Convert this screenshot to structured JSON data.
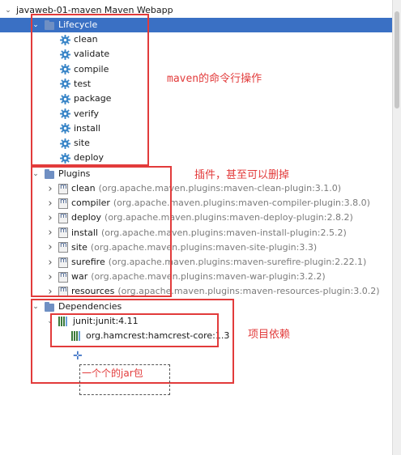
{
  "project": {
    "title": "javaweb-01-maven Maven Webapp"
  },
  "lifecycle": {
    "label": "Lifecycle",
    "items": [
      "clean",
      "validate",
      "compile",
      "test",
      "package",
      "verify",
      "install",
      "site",
      "deploy"
    ]
  },
  "plugins": {
    "label": "Plugins",
    "items": [
      {
        "name": "clean",
        "artifact": "(org.apache.maven.plugins:maven-clean-plugin:3.1.0)"
      },
      {
        "name": "compiler",
        "artifact": "(org.apache.maven.plugins:maven-compiler-plugin:3.8.0)"
      },
      {
        "name": "deploy",
        "artifact": "(org.apache.maven.plugins:maven-deploy-plugin:2.8.2)"
      },
      {
        "name": "install",
        "artifact": "(org.apache.maven.plugins:maven-install-plugin:2.5.2)"
      },
      {
        "name": "site",
        "artifact": "(org.apache.maven.plugins:maven-site-plugin:3.3)"
      },
      {
        "name": "surefire",
        "artifact": "(org.apache.maven.plugins:maven-surefire-plugin:2.22.1)"
      },
      {
        "name": "war",
        "artifact": "(org.apache.maven.plugins:maven-war-plugin:3.2.2)"
      },
      {
        "name": "resources",
        "artifact": "(org.apache.maven.plugins:maven-resources-plugin:3.0.2)"
      }
    ]
  },
  "dependencies": {
    "label": "Dependencies",
    "items": [
      {
        "name": "junit:junit:4.11",
        "children": [
          "org.hamcrest:hamcrest-core:1.3"
        ]
      }
    ]
  },
  "annotations": {
    "lifecycle_note": "maven的命令行操作",
    "plugins_note": "插件，甚至可以删掉",
    "dependencies_note": "项目依赖",
    "jar_note": "一个个的jar包"
  },
  "colors": {
    "annotation": "#e23b3b",
    "selection": "#3a70c4"
  }
}
